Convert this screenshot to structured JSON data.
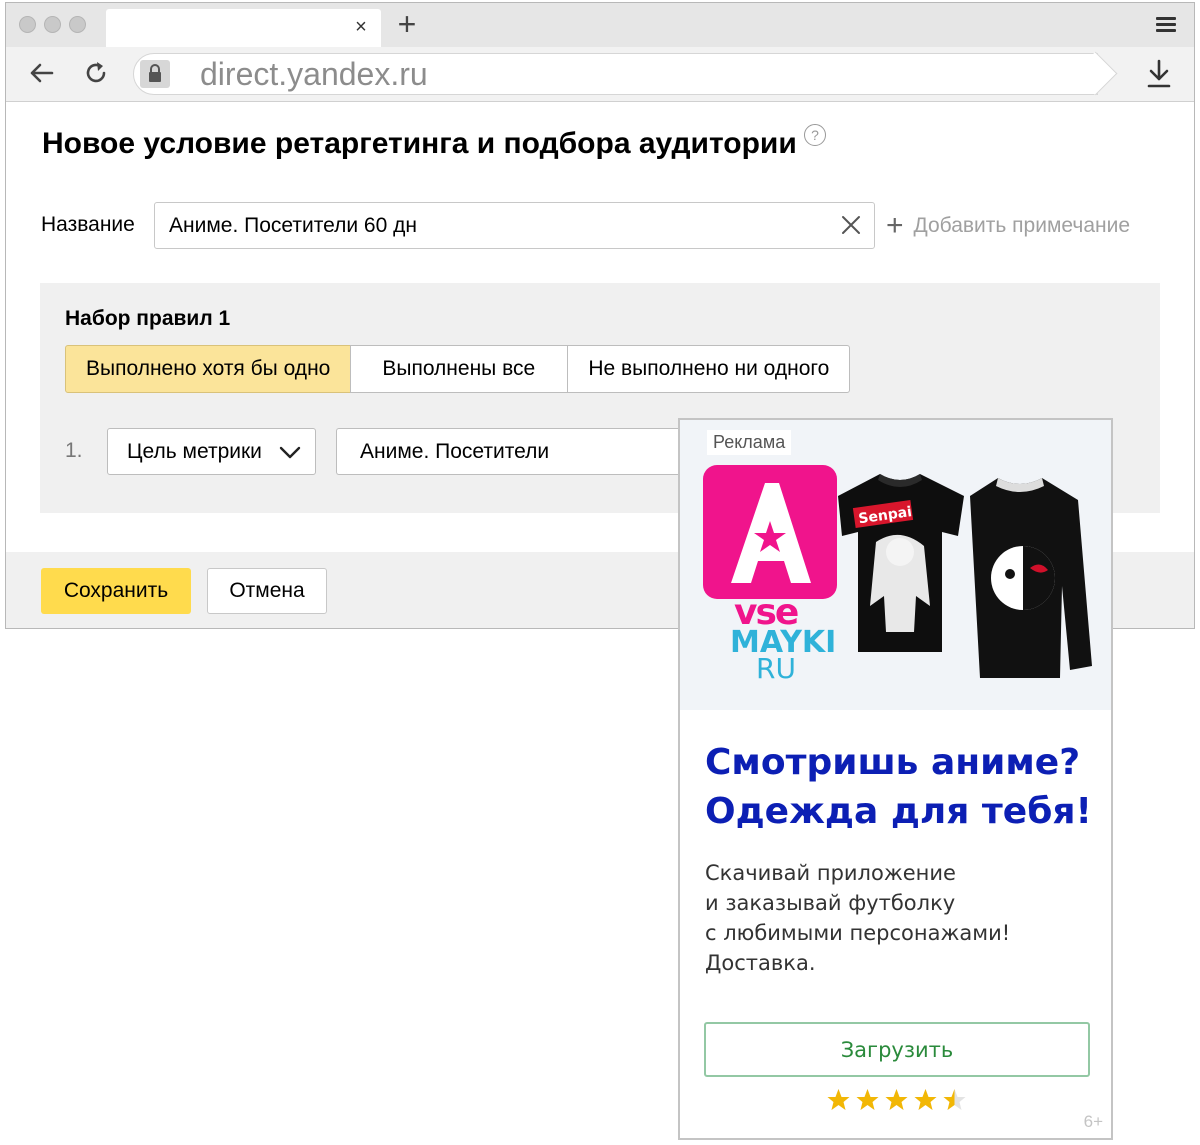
{
  "browser": {
    "url": "direct.yandex.ru",
    "tab_close": "×",
    "new_tab": "+"
  },
  "page": {
    "title": "Новое условие ретаргетинга и подбора аудитории",
    "help": "?",
    "name_label": "Название",
    "name_value": "Аниме. Посетители 60 дн",
    "add_note": "Добавить примечание"
  },
  "rules": {
    "title": "Набор правил 1",
    "modes": [
      "Выполнено хотя бы одно",
      "Выполнены все",
      "Не выполнено ни одного"
    ],
    "active_mode": 0,
    "rule_number": "1.",
    "rule_type": "Цель метрики",
    "rule_goal": "Аниме. Посетители"
  },
  "footer": {
    "save": "Сохранить",
    "cancel": "Отмена"
  },
  "ad": {
    "label": "Реклама",
    "brand": [
      "vse",
      "MAYKI",
      "RU"
    ],
    "shirt_print": "Senpai",
    "headline": [
      "Смотришь аниме?",
      "Одежда для тебя!"
    ],
    "body": [
      "Скачивай приложение",
      "и заказывай футболку",
      "с любимыми персонажами!",
      "Доставка."
    ],
    "cta": "Загрузить",
    "rating": 4.5,
    "age": "6+"
  },
  "colors": {
    "save_button": "#ffdb4d",
    "active_segment": "#fbe49a",
    "brand_pink": "#f0148c",
    "headline_blue": "#0c1fb4",
    "star": "#f2b705"
  },
  "icons": [
    "lock-icon",
    "back-icon",
    "reload-icon",
    "download-icon",
    "menu-icon",
    "help-icon",
    "clear-icon",
    "plus-icon",
    "chevron-down-icon",
    "star-icon"
  ]
}
